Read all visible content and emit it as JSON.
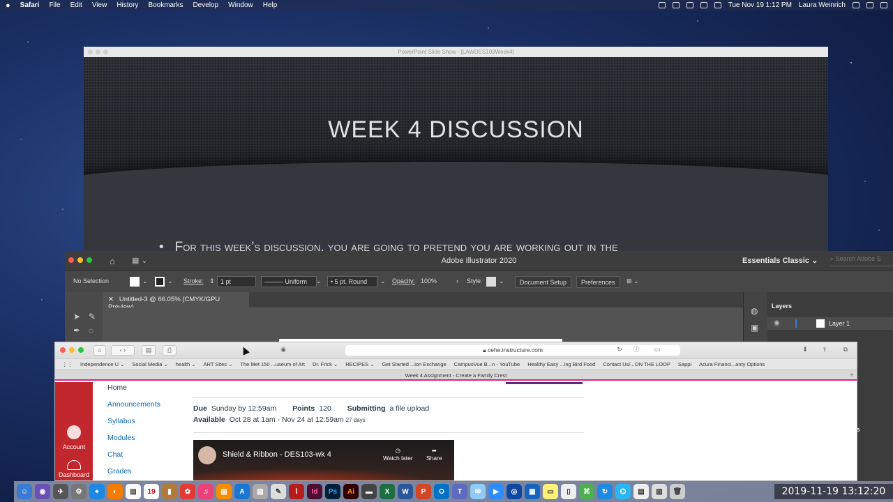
{
  "menubar": {
    "app": "Safari",
    "items": [
      "File",
      "Edit",
      "View",
      "History",
      "Bookmarks",
      "Develop",
      "Window",
      "Help"
    ],
    "datetime": "Tue Nov 19  1:12 PM",
    "user": "Laura Weinrich"
  },
  "ppt": {
    "window_title": "PowerPoint Slide Show - [LAWDES103Week4]",
    "slide_title": "WEEK 4 DISCUSSION",
    "bullet": "For this week’s discussion, you are going to pretend you are working out in the"
  },
  "illustrator": {
    "app_title": "Adobe Illustrator 2020",
    "workspace": "Essentials Classic",
    "search_placeholder": "Search Adobe S",
    "control": {
      "selection": "No Selection",
      "stroke_label": "Stroke:",
      "stroke_weight": "1 pt",
      "profile": "Uniform",
      "brush": "5 pt. Round",
      "opacity_label": "Opacity:",
      "opacity": "100%",
      "style_label": "Style:",
      "document_setup": "Document Setup",
      "preferences": "Preferences"
    },
    "doc_tab": "Untitled-3 @ 66.05% (CMYK/GPU Preview)",
    "layers_title": "Layers",
    "layer_name": "Layer 1",
    "panel_snippet": "atches"
  },
  "safari": {
    "url": "cehe.instructure.com",
    "favorites": [
      "Independence U ⌄",
      "Social Media ⌄",
      "health ⌄",
      "ART Sites ⌄",
      "The Met 150 ...useum of Art",
      "Dr. Frick ⌄",
      "RECIPES ⌄",
      "Get Started ...ion Exchange",
      "CampusVue B...n - YouTube",
      "Healthy Easy ...ing Bird Food",
      "Contact Us/...ON THE LOOP",
      "Sappi",
      "Acura Financi...anty Options"
    ],
    "tab_title": "Week 4 Assignment - Create a Family Crest"
  },
  "canvas": {
    "global_nav": {
      "account": "Account",
      "dashboard": "Dashboard"
    },
    "course_nav": [
      "Home",
      "Announcements",
      "Syllabus",
      "Modules",
      "Chat",
      "Grades"
    ],
    "assignment": {
      "due_label": "Due",
      "due_value": "Sunday by 12:59am",
      "points_label": "Points",
      "points_value": "120",
      "submitting_label": "Submitting",
      "submitting_value": "a file upload",
      "available_label": "Available",
      "available_value": "Oct 28 at 1am - Nov 24 at 12:59am",
      "available_days": "27 days"
    },
    "video": {
      "title": "Shield & Ribbon - DES103-wk 4",
      "watch_later": "Watch later",
      "share": "Share"
    }
  },
  "timestamp": "2019-11-19 13:12:20"
}
